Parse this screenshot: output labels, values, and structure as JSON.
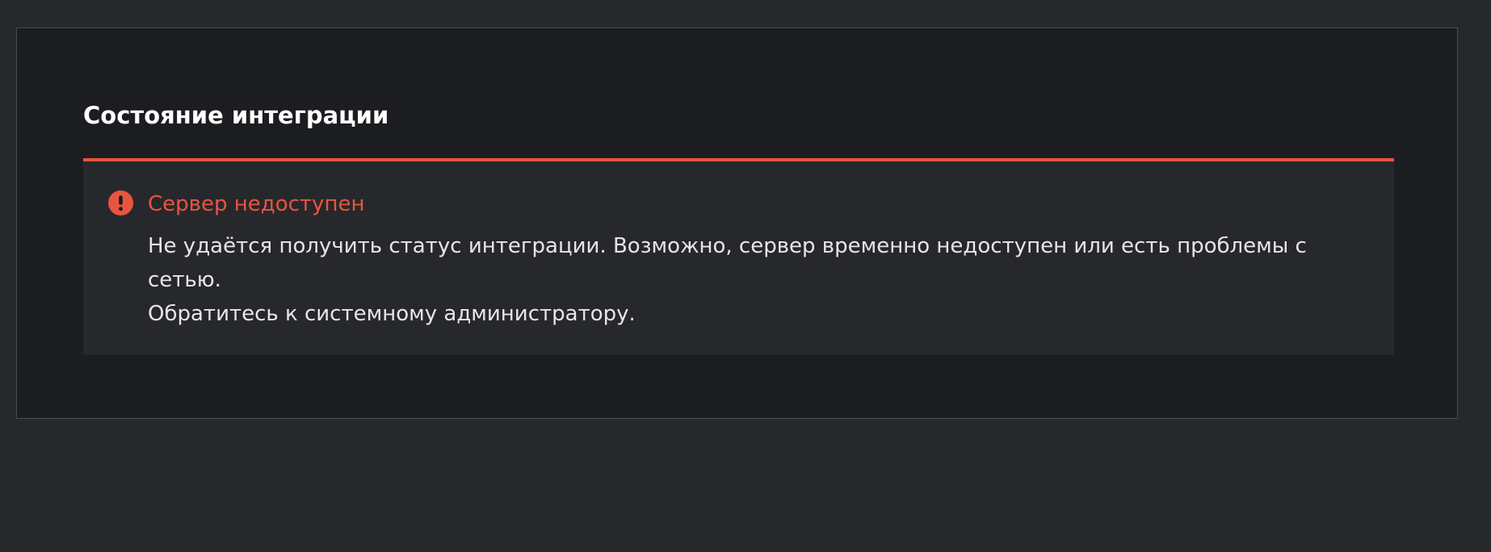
{
  "panel": {
    "title": "Состояние интеграции"
  },
  "alert": {
    "icon": "exclamation-circle-icon",
    "title": "Сервер недоступен",
    "body_lines": [
      "Не удаётся получить статус интеграции. Возможно, сервер временно недоступен или есть проблемы с",
      "сетью.",
      "Обратитесь к системному администратору."
    ]
  },
  "colors": {
    "page_background": "#27282c",
    "panel_background": "#1c1d20",
    "panel_border": "#4a4b50",
    "alert_background": "#27282c",
    "alert_accent": "#e8553f",
    "title_text": "#ffffff",
    "body_text": "#e6e6e6"
  }
}
